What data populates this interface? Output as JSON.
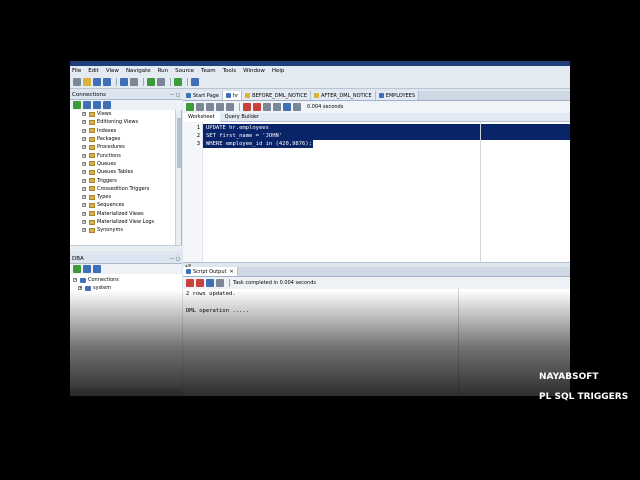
{
  "menu": [
    "File",
    "Edit",
    "View",
    "Navigate",
    "Run",
    "Source",
    "Team",
    "Tools",
    "Window",
    "Help"
  ],
  "connections_panel": {
    "title": "Connections",
    "tree_items": [
      "Views",
      "Editioning Views",
      "Indexes",
      "Packages",
      "Procedures",
      "Functions",
      "Queues",
      "Queues Tables",
      "Triggers",
      "Crossedition Triggers",
      "Types",
      "Sequences",
      "Materialized Views",
      "Materialized View Logs",
      "Synonyms"
    ]
  },
  "dba_panel": {
    "title": "DBA",
    "tree_items": [
      "Connections",
      "system"
    ]
  },
  "editor_tabs": [
    "Start Page",
    "hr",
    "BEFORE_DML_NOTICE",
    "AFTER_DML_NOTICE",
    "EMPLOYEES"
  ],
  "worksheet": {
    "timing": "0.004 seconds",
    "subtabs": [
      "Worksheet",
      "Query Builder"
    ],
    "lines": [
      {
        "num": "1",
        "code": "UPDATE hr.employees"
      },
      {
        "num": "2",
        "code": "SET  first_name = 'JOHN'"
      },
      {
        "num": "3",
        "code": "WHERE employee_id in (420,9876);"
      }
    ]
  },
  "script_output": {
    "tab_label": "Script Output",
    "status": "Task completed in 0.004 seconds",
    "lines": [
      "2 rows updated.",
      "DML operation ....."
    ]
  },
  "watermark": {
    "brand": "NAYABSOFT",
    "topic": "PL SQL TRIGGERS"
  },
  "colors": {
    "selection": "#0a246a",
    "titlebar": "#1f3f7a"
  }
}
